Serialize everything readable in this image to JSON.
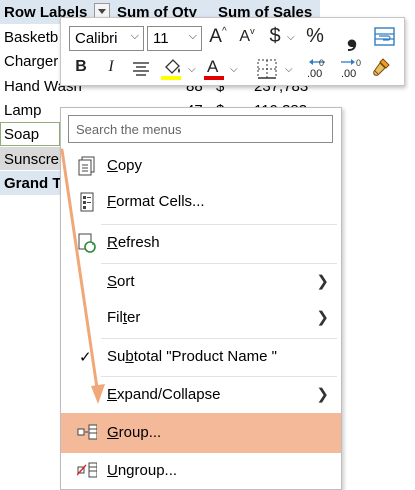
{
  "pivot": {
    "headers": {
      "row_labels": "Row Labels",
      "qty": "Sum of Qty",
      "sales": "Sum of Sales"
    },
    "rows": [
      {
        "label": "Basketb",
        "qty": "",
        "cur": "",
        "sales": ""
      },
      {
        "label": "Charger",
        "qty": "",
        "cur": "",
        "sales": ""
      },
      {
        "label": "Hand Wash",
        "qty": "88",
        "cur": "$",
        "sales": "237,783"
      },
      {
        "label": "Lamp",
        "qty": "47",
        "cur": "$",
        "sales": "119,383"
      },
      {
        "label": "Soap",
        "qty": "",
        "cur": "",
        "sales": ""
      },
      {
        "label": "Sunscre",
        "qty": "",
        "cur": "",
        "sales": ""
      },
      {
        "label": "Grand T",
        "qty": "",
        "cur": "",
        "sales": ""
      }
    ]
  },
  "mini_toolbar": {
    "font_name": "Calibri",
    "font_size": "11",
    "grow_font": "A",
    "shrink_font": "A",
    "currency": "$",
    "percent": "%",
    "comma": "❟",
    "bold": "B",
    "italic": "I",
    "font_color_letter": "A",
    "dec_increase": ".00",
    "dec_decrease": ".00",
    "fill_color": "#ffff00",
    "font_color": "#e00000"
  },
  "menu": {
    "search_placeholder": "Search the menus",
    "items": [
      {
        "pre": "",
        "key": "C",
        "post": "opy"
      },
      {
        "pre": "",
        "key": "F",
        "post": "ormat Cells..."
      },
      {
        "pre": "",
        "key": "R",
        "post": "efresh"
      },
      {
        "pre": "",
        "key": "S",
        "post": "ort"
      },
      {
        "pre": "Fil",
        "key": "t",
        "post": "er"
      },
      {
        "pre": "Su",
        "key": "b",
        "post": "total \"Product Name \""
      },
      {
        "pre": "",
        "key": "E",
        "post": "xpand/Collapse"
      },
      {
        "pre": "",
        "key": "G",
        "post": "roup..."
      },
      {
        "pre": "",
        "key": "U",
        "post": "ngroup..."
      }
    ],
    "highlight_color": "#f4b999"
  },
  "colors": {
    "header_bg": "#dce6f1",
    "arrow": "#f0a878"
  }
}
